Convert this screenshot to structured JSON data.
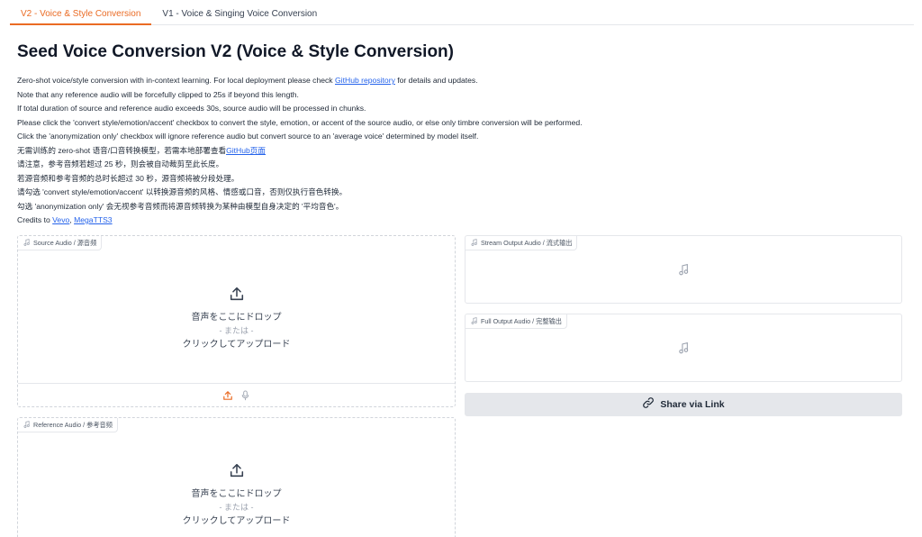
{
  "tabs": [
    {
      "label": "V2 - Voice & Style Conversion"
    },
    {
      "label": "V1 - Voice & Singing Voice Conversion"
    }
  ],
  "title": "Seed Voice Conversion V2 (Voice & Style Conversion)",
  "description": {
    "line1_pre": "Zero-shot voice/style conversion with in-context learning. For local deployment please check ",
    "line1_link": "GitHub repository",
    "line1_post": " for details and updates.",
    "line2": "Note that any reference audio will be forcefully clipped to 25s if beyond this length.",
    "line3": "If total duration of source and reference audio exceeds 30s, source audio will be processed in chunks.",
    "line4": "Please click the 'convert style/emotion/accent' checkbox to convert the style, emotion, or accent of the source audio, or else only timbre conversion will be performed.",
    "line5": "Click the 'anonymization only' checkbox will ignore reference audio but convert source to an 'average voice' determined by model itself.",
    "line6_pre": "无需训练的 zero-shot 语音/口音转换模型，若需本地部署查看",
    "line6_link": "GitHub页面",
    "line7": "请注意，参考音频若超过 25 秒，则会被自动裁剪至此长度。",
    "line8": "若源音频和参考音频的总时长超过 30 秒，源音频将被分段处理。",
    "line9": "请勾选 'convert style/emotion/accent' 以转换源音频的风格、情感或口音，否则仅执行音色转换。",
    "line10": "勾选 'anonymization only' 会无视参考音频而将源音频转换为某种由模型自身决定的 '平均音色'。",
    "credits_pre": "Credits to ",
    "credits_link1": "Vevo",
    "credits_sep": ", ",
    "credits_link2": "MegaTTS3"
  },
  "source_audio": {
    "label": "Source Audio / 源音频",
    "drop_text": "音声をここにドロップ",
    "or_text": "- または -",
    "click_text": "クリックしてアップロード"
  },
  "reference_audio": {
    "label": "Reference Audio / 参考音频",
    "drop_text": "音声をここにドロップ",
    "or_text": "- または -",
    "click_text": "クリックしてアップロード"
  },
  "stream_output": {
    "label": "Stream Output Audio / 流式输出"
  },
  "full_output": {
    "label": "Full Output Audio / 完整输出"
  },
  "share_button": {
    "label": "Share via Link"
  },
  "colors": {
    "accent": "#ea6b24",
    "link": "#2563eb",
    "share_bg": "#e5e7eb"
  },
  "icons": [
    "music-note-icon",
    "upload-icon",
    "microphone-icon",
    "link-icon"
  ]
}
